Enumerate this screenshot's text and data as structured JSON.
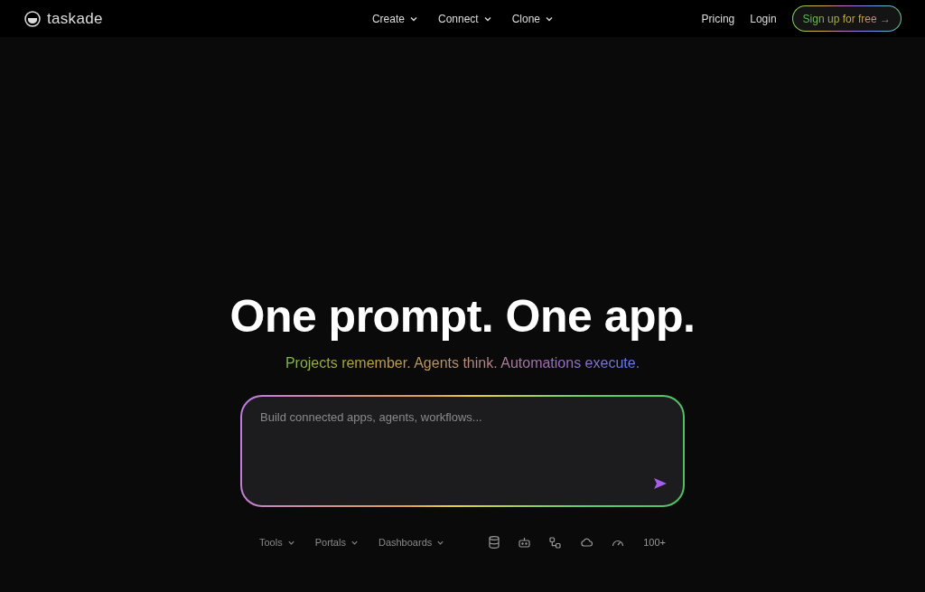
{
  "brand": {
    "name": "taskade"
  },
  "nav": {
    "menus": [
      {
        "label": "Create"
      },
      {
        "label": "Connect"
      },
      {
        "label": "Clone"
      }
    ],
    "links": [
      "Pricing",
      "Login"
    ],
    "cta": "Sign up for free →"
  },
  "hero": {
    "title": "One prompt. One app.",
    "subtitle": "Projects remember. Agents think. Automations execute.",
    "prompt": {
      "placeholder": "Build connected apps, agents, workflows..."
    }
  },
  "toolbar": {
    "menus": [
      {
        "label": "Tools"
      },
      {
        "label": "Portals"
      },
      {
        "label": "Dashboards"
      }
    ],
    "more": "100+"
  }
}
